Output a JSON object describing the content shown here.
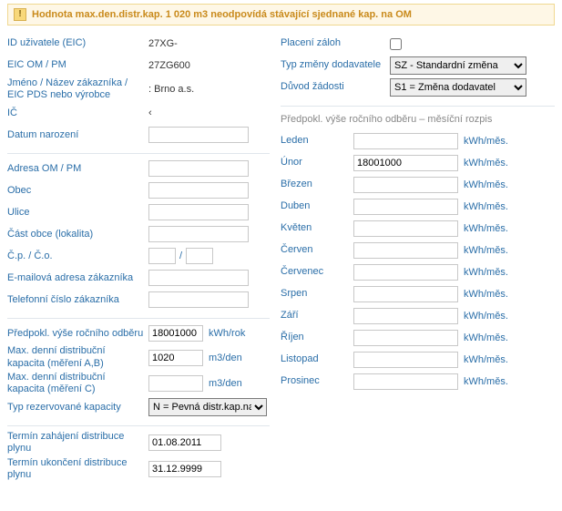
{
  "warning": {
    "text": "Hodnota max.den.distr.kap. 1 020 m3 neodpovídá stávající sjednané kap. na OM"
  },
  "left": {
    "user_id": {
      "label": "ID uživatele (EIC)",
      "value": "27XG-"
    },
    "eic_om_pm": {
      "label": "EIC OM / PM",
      "value": "27ZG600"
    },
    "name": {
      "label": "Jméno / Název zákazníka / EIC PDS nebo výrobce",
      "value": ":         Brno a.s."
    },
    "ic": {
      "label": "IČ",
      "value": "‹"
    },
    "birth": {
      "label": "Datum narození",
      "value": ""
    },
    "addr": {
      "label": "Adresa OM / PM"
    },
    "obec": {
      "label": "Obec"
    },
    "ulice": {
      "label": "Ulice"
    },
    "lokalita": {
      "label": "Část obce (lokalita)"
    },
    "cp": {
      "label": "Č.p. / Č.o."
    },
    "email": {
      "label": "E-mailová adresa zákazníka"
    },
    "phone": {
      "label": "Telefonní číslo zákazníka"
    },
    "annual": {
      "label": "Předpokl. výše ročního odběru",
      "value": "18001000",
      "unit": "kWh/rok"
    },
    "max_day_ab": {
      "label": "Max. denní distribuční kapacita (měření A,B)",
      "value": "1020",
      "unit": "m3/den"
    },
    "max_day_c": {
      "label": "Max. denní distribuční kapacita (měření C)",
      "value": "",
      "unit": "m3/den"
    },
    "cap_type": {
      "label": "Typ rezervované kapacity",
      "value": "N = Pevná distr.kap.na r"
    },
    "start": {
      "label": "Termín zahájení distribuce plynu",
      "value": "01.08.2011"
    },
    "end": {
      "label": "Termín ukončení distribuce plynu",
      "value": "31.12.9999"
    }
  },
  "right": {
    "advance": {
      "label": "Placení záloh"
    },
    "change_type": {
      "label": "Typ změny dodavatele",
      "value": "SZ - Standardní změna"
    },
    "reason": {
      "label": "Důvod žádosti",
      "value": "S1 = Změna dodavatel"
    },
    "breakdown_head": "Předpokl. výše ročního odběru – měsíční rozpis",
    "unit": "kWh/měs.",
    "months": [
      {
        "name": "Leden",
        "value": ""
      },
      {
        "name": "Únor",
        "value": "18001000"
      },
      {
        "name": "Březen",
        "value": ""
      },
      {
        "name": "Duben",
        "value": ""
      },
      {
        "name": "Květen",
        "value": ""
      },
      {
        "name": "Červen",
        "value": ""
      },
      {
        "name": "Červenec",
        "value": ""
      },
      {
        "name": "Srpen",
        "value": ""
      },
      {
        "name": "Září",
        "value": ""
      },
      {
        "name": "Říjen",
        "value": ""
      },
      {
        "name": "Listopad",
        "value": ""
      },
      {
        "name": "Prosinec",
        "value": ""
      }
    ]
  }
}
